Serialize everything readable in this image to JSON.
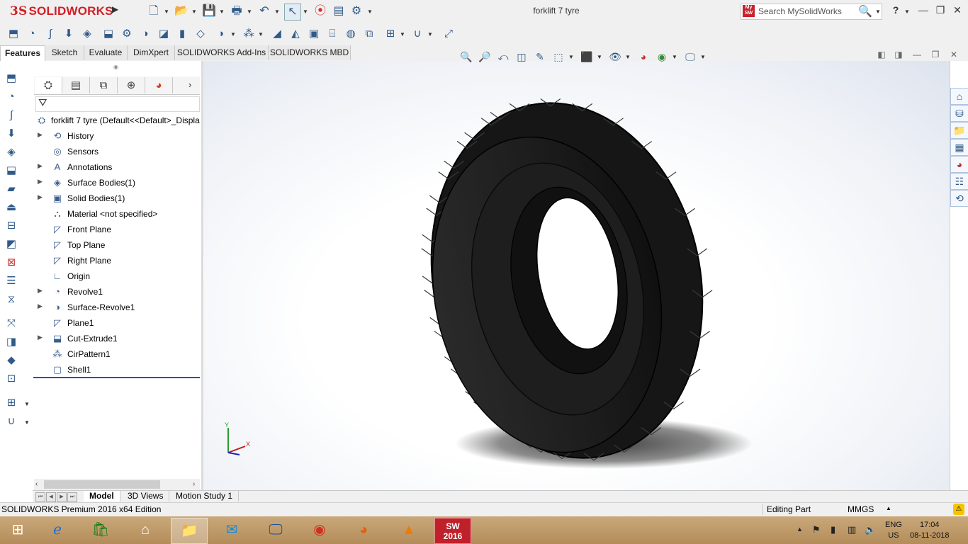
{
  "app": {
    "logo_prefix": "3S",
    "logo_text": "SOLIDWORKS",
    "document_title": "forklift 7 tyre"
  },
  "search": {
    "logo_text": "My SW",
    "placeholder": "Search MySolidWorks"
  },
  "window_controls": {
    "help": "?",
    "minimize": "—",
    "restore": "❐",
    "close": "✕"
  },
  "tabs": [
    {
      "label": "Features",
      "active": true
    },
    {
      "label": "Sketch"
    },
    {
      "label": "Evaluate"
    },
    {
      "label": "DimXpert"
    },
    {
      "label": "SOLIDWORKS Add-Ins"
    },
    {
      "label": "SOLIDWORKS MBD"
    }
  ],
  "feature_tree": {
    "root": "forklift 7 tyre  (Default<<Default>_Displa",
    "items": [
      {
        "label": "History",
        "icon": "history-icon",
        "expandable": true
      },
      {
        "label": "Sensors",
        "icon": "sensors-icon",
        "expandable": false
      },
      {
        "label": "Annotations",
        "icon": "annotations-icon",
        "expandable": true
      },
      {
        "label": "Surface Bodies(1)",
        "icon": "surface-bodies-icon",
        "expandable": true
      },
      {
        "label": "Solid Bodies(1)",
        "icon": "solid-bodies-icon",
        "expandable": true
      },
      {
        "label": "Material <not specified>",
        "icon": "material-icon",
        "expandable": false
      },
      {
        "label": "Front Plane",
        "icon": "plane-icon",
        "expandable": false
      },
      {
        "label": "Top Plane",
        "icon": "plane-icon",
        "expandable": false
      },
      {
        "label": "Right Plane",
        "icon": "plane-icon",
        "expandable": false
      },
      {
        "label": "Origin",
        "icon": "origin-icon",
        "expandable": false
      },
      {
        "label": "Revolve1",
        "icon": "revolve-icon",
        "expandable": true
      },
      {
        "label": "Surface-Revolve1",
        "icon": "surface-revolve-icon",
        "expandable": true
      },
      {
        "label": "Plane1",
        "icon": "plane-icon",
        "expandable": false
      },
      {
        "label": "Cut-Extrude1",
        "icon": "cut-extrude-icon",
        "expandable": true
      },
      {
        "label": "CirPattern1",
        "icon": "circular-pattern-icon",
        "expandable": false
      },
      {
        "label": "Shell1",
        "icon": "shell-icon",
        "expandable": false
      }
    ]
  },
  "triad": {
    "x": "X",
    "y": "Y"
  },
  "bottom_tabs": [
    {
      "label": "Model",
      "active": true
    },
    {
      "label": "3D Views"
    },
    {
      "label": "Motion Study 1"
    }
  ],
  "status": {
    "edition": "SOLIDWORKS Premium 2016 x64 Edition",
    "mode": "Editing Part",
    "units": "MMGS"
  },
  "taskbar": {
    "sw_label": "2016",
    "lang_line1": "ENG",
    "lang_line2": "US",
    "time": "17:04",
    "date": "08-11-2018"
  }
}
